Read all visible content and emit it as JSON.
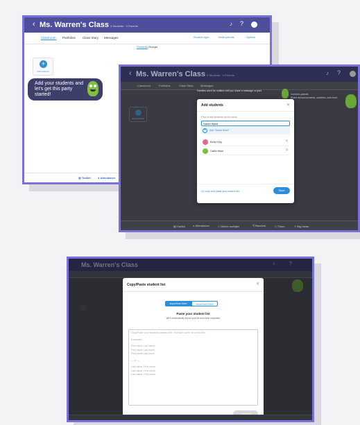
{
  "colors": {
    "accent": "#2c8fd8",
    "header": "#4d4f9b",
    "frame_border": "#7a71d8",
    "mascot": "#7cc142"
  },
  "frame1": {
    "header": {
      "title": "Ms. Warren's Class",
      "meta": "3 Students · 3 Parents"
    },
    "tabs": [
      "Classroom",
      "Portfolios",
      "Class Story",
      "Messages"
    ],
    "right_links": [
      "Student login",
      "Invite parents",
      "Options"
    ],
    "subtabs": {
      "students": "Students",
      "groups": "Groups"
    },
    "add_card_label": "Add students",
    "tip_lines": [
      "Add your students and",
      "let's get this party",
      "started!"
    ],
    "bottom": [
      "Toolkit",
      "Attendance"
    ]
  },
  "frame2": {
    "header": {
      "title": "Ms. Warren's Class",
      "meta": "0 Students · 0 Parents"
    },
    "tabs": [
      "Classroom",
      "Portfolios",
      "Class Story",
      "Messages"
    ],
    "banner": "Families won't be notified until you share a message or post",
    "promo": [
      "Connect parents",
      "Share announcements, activities, and more."
    ],
    "card_label": "Add students",
    "modal": {
      "title": "Add students",
      "hint": "First or add students by full name",
      "input_value": "Sarah Ward",
      "add_suggestion": "Add \"Sarah Ward\"",
      "students": [
        "Emily King",
        "Caitlin Ward"
      ],
      "copy_link": "Or, copy and paste your student list",
      "save": "Save"
    },
    "bottom": [
      "Toolkit",
      "Attendance",
      "Select multiple",
      "Random",
      "Timer",
      "Big ideas"
    ]
  },
  "frame3": {
    "header": {
      "title": "Ms. Warren's Class"
    },
    "modal": {
      "title": "Copy/Paste student list",
      "seg_active": "Import from Word",
      "seg_inactive": "Import from Excel",
      "heading": "Paste your student list",
      "sub": "We'll automatically import your list and clean duplicates",
      "textarea_lines": [
        "Copy/Paste your students names here. Put each name on a new line.",
        "",
        "Examples:",
        "",
        "First name Last Name",
        "First name Last name",
        "First name Last name",
        "",
        "— or —",
        "",
        "Last name, First name",
        "Last name, First name",
        "Last name, First name"
      ],
      "import_button": "Import list"
    }
  }
}
